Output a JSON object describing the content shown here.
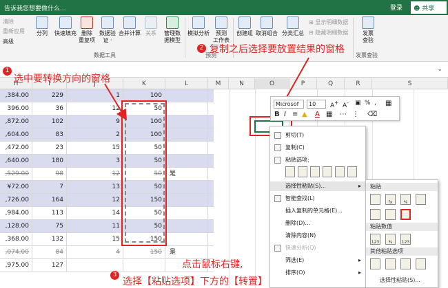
{
  "titlebar": {
    "tellme": "告诉我您想要做什么...",
    "login": "登录",
    "share": "共享"
  },
  "ribbon": {
    "left_items": [
      "清除",
      "重新应用",
      "高级"
    ],
    "buttons": [
      {
        "label": "分列"
      },
      {
        "label": "快速填充"
      },
      {
        "label": "删除\n重复项"
      },
      {
        "label": "数据验\n证 ·"
      },
      {
        "label": "合并计算"
      },
      {
        "label": "关系"
      },
      {
        "label": "管理数\n据模型"
      },
      {
        "label": "模拟分析"
      },
      {
        "label": "预测\n工作表"
      },
      {
        "label": "创建组"
      },
      {
        "label": "取消组合"
      },
      {
        "label": "分类汇总"
      },
      {
        "label": "发票\n查验"
      }
    ],
    "small_items": [
      "显示明细数据",
      "隐藏明细数据"
    ],
    "group_label": "数据工具",
    "group_label2": "预测",
    "group_label3": "发票查验"
  },
  "columns": [
    "H",
    "I",
    "J",
    "K",
    "L",
    "M",
    "N",
    "O",
    "P",
    "Q",
    "R",
    "S"
  ],
  "rows": [
    {
      "h": ",384.00",
      "i": "229",
      "j": "1",
      "k": "100",
      "l": "",
      "shade": true,
      "strike": false
    },
    {
      "h": "396.00",
      "i": "36",
      "j": "12",
      "k": "50",
      "l": "",
      "shade": false,
      "strike": false
    },
    {
      "h": ",872.00",
      "i": "102",
      "j": "9",
      "k": "100",
      "l": "",
      "shade": true,
      "strike": false
    },
    {
      "h": ",604.00",
      "i": "83",
      "j": "2",
      "k": "100",
      "l": "",
      "shade": true,
      "strike": false
    },
    {
      "h": ",472.00",
      "i": "23",
      "j": "15",
      "k": "50",
      "l": "",
      "shade": false,
      "strike": false
    },
    {
      "h": ",640.00",
      "i": "180",
      "j": "3",
      "k": "50",
      "l": "",
      "shade": true,
      "strike": false
    },
    {
      "h": ",529.00",
      "i": "98",
      "j": "12",
      "k": "50",
      "l": "是",
      "shade": false,
      "strike": true
    },
    {
      "h": "¥72.00",
      "i": "7",
      "j": "13",
      "k": "50",
      "l": "",
      "shade": true,
      "strike": false
    },
    {
      "h": ",726.00",
      "i": "164",
      "j": "12",
      "k": "150",
      "l": "",
      "shade": true,
      "strike": false
    },
    {
      "h": ",984.00",
      "i": "113",
      "j": "14",
      "k": "50",
      "l": "",
      "shade": false,
      "strike": false
    },
    {
      "h": ",128.00",
      "i": "75",
      "j": "11",
      "k": "50",
      "l": "",
      "shade": true,
      "strike": false
    },
    {
      "h": ",368.00",
      "i": "132",
      "j": "15",
      "k": "150",
      "l": "",
      "shade": false,
      "strike": false
    },
    {
      "h": ",074.00",
      "i": "84",
      "j": "4",
      "k": "150",
      "l": "是",
      "shade": false,
      "strike": true
    },
    {
      "h": ",975.00",
      "i": "127",
      "j": "",
      "k": "",
      "l": "",
      "shade": false,
      "strike": false
    }
  ],
  "annotations": {
    "n1": "1",
    "t1": "选中要转换方向的窗格",
    "n2": "2",
    "t2": "复制之后选择要放置结果的窗格",
    "n3": "3",
    "t3a": "点击鼠标右键,",
    "t3b": "选择【粘贴选项】下方的【转置】"
  },
  "mini_toolbar": {
    "font": "Microsof",
    "size": "10",
    "pct": "%"
  },
  "context_menu": {
    "items": [
      "剪切(T)",
      "复制(C)",
      "粘贴选项:",
      "选择性粘贴(S)...",
      "智能查找(L)",
      "插入复制的单元格(E)...",
      "删除(D)...",
      "清除内容(N)",
      "快速分析(Q)",
      "筛选(E)",
      "排序(O)"
    ]
  },
  "submenu": {
    "h1": "粘贴",
    "h2": "粘贴数值",
    "h3": "其他粘贴选项",
    "footer": "选择性粘贴(S)..."
  },
  "colors": {
    "excel_green": "#217346",
    "annot_red": "#e02424",
    "shade": "#d9dcef"
  }
}
